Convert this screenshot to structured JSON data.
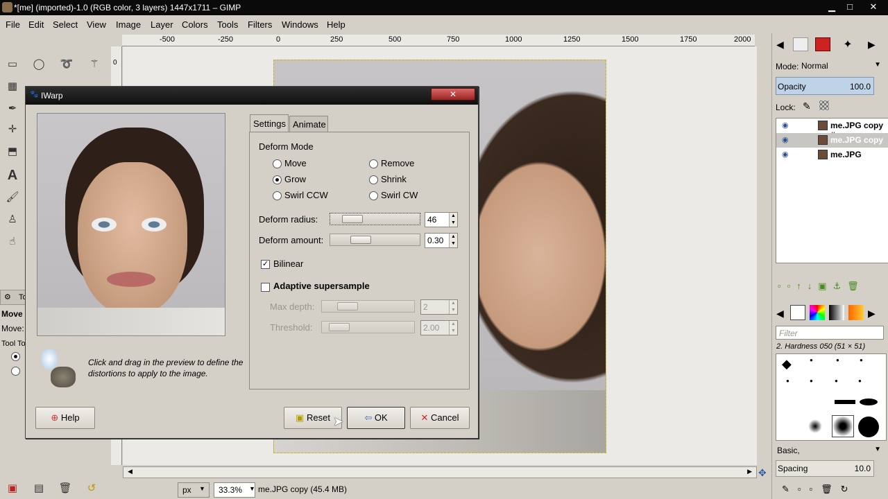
{
  "window": {
    "title": "*[me] (imported)-1.0 (RGB color, 3 layers) 1447x1711 – GIMP",
    "minimize": "▁",
    "maximize": "□",
    "close": "✕"
  },
  "menu": [
    "File",
    "Edit",
    "Select",
    "View",
    "Image",
    "Layer",
    "Colors",
    "Tools",
    "Filters",
    "Windows",
    "Help"
  ],
  "ruler": {
    "top_labels": [
      "-500",
      "-250",
      "0",
      "250",
      "500",
      "750",
      "1000",
      "1250",
      "1500",
      "1750",
      "2000"
    ],
    "left_label": "0"
  },
  "toolbox": {
    "tool_options_label": "Move",
    "move_label": "Move:",
    "tool_toggle_label": "Tool To",
    "tab_short": "To"
  },
  "statusbar": {
    "unit": "px",
    "zoom": "33.3%",
    "info": "me.JPG copy (45.4 MB)"
  },
  "dock": {
    "mode_label": "Mode:",
    "mode_value": "Normal",
    "opacity_label": "Opacity",
    "opacity_value": "100.0",
    "lock_label": "Lock:",
    "layers": [
      {
        "name": "me.JPG copy #",
        "selected": false
      },
      {
        "name": "me.JPG copy",
        "selected": true
      },
      {
        "name": "me.JPG",
        "selected": false
      }
    ],
    "filter_placeholder": "Filter",
    "brush_name": "2. Hardness 050 (51 × 51)",
    "brush_preset": "Basic,",
    "spacing_label": "Spacing",
    "spacing_value": "10.0"
  },
  "dialog": {
    "title": "IWarp",
    "tabs": [
      "Settings",
      "Animate"
    ],
    "deform_mode_title": "Deform Mode",
    "modes": {
      "move": "Move",
      "grow": "Grow",
      "swirl_ccw": "Swirl CCW",
      "remove": "Remove",
      "shrink": "Shrink",
      "swirl_cw": "Swirl CW"
    },
    "selected_mode": "Grow",
    "deform_radius_label": "Deform radius:",
    "deform_radius_value": "46",
    "deform_radius_fraction": 0.18,
    "deform_amount_label": "Deform amount:",
    "deform_amount_value": "0.30",
    "deform_amount_fraction": 0.3,
    "bilinear_label": "Bilinear",
    "bilinear_checked": true,
    "adaptive_label": "Adaptive supersample",
    "adaptive_checked": false,
    "max_depth_label": "Max depth:",
    "max_depth_value": "2",
    "threshold_label": "Threshold:",
    "threshold_value": "2.00",
    "hint": "Click and drag in the preview to define the distortions to apply to the image.",
    "buttons": {
      "help": "Help",
      "reset": "Reset",
      "ok": "OK",
      "cancel": "Cancel"
    }
  }
}
